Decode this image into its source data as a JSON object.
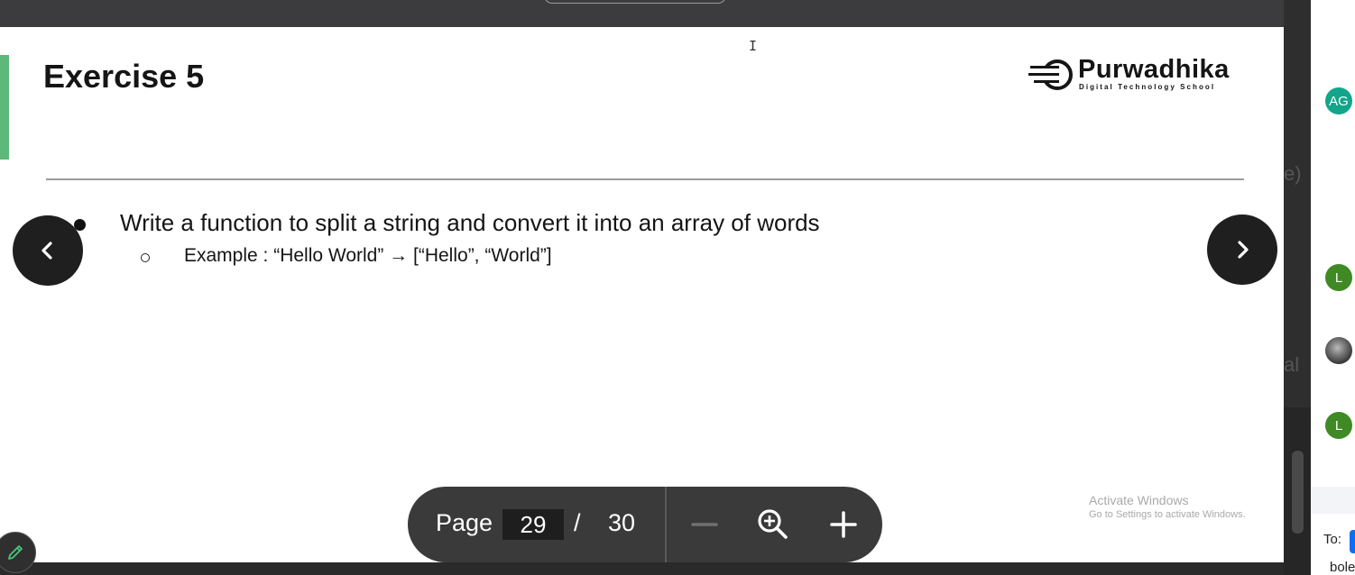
{
  "slide": {
    "title": "Exercise 5",
    "logo": {
      "name": "Purwadhika",
      "tagline": "Digital Technology School"
    },
    "bullet": "Write a function to split a string and convert it into an array of words",
    "sub_bullet": "Example : “Hello World” → [“Hello”, “World”]"
  },
  "pager": {
    "label": "Page",
    "current": "29",
    "separator": "/",
    "total": "30"
  },
  "watermark": {
    "line1": "Activate Windows",
    "line2": "Go to Settings to activate Windows."
  },
  "side_panel": {
    "ghost_top": "e)",
    "ghost_bottom": "al",
    "avatars": [
      {
        "initials": "AG",
        "color": "#12a58a"
      },
      {
        "initials": "L",
        "color": "#3f8a24"
      },
      {
        "initials": "",
        "color": "#777777"
      },
      {
        "initials": "L",
        "color": "#3f8a24"
      }
    ],
    "to_label": "To:",
    "message_fragment": "bole"
  },
  "colors": {
    "accent_bar": "#5cb97a",
    "nav_button": "#1f1f1f",
    "pager_bg": "#3a3a3a"
  },
  "icons": [
    "chevron-left-icon",
    "chevron-right-icon",
    "minus-icon",
    "zoom-in-icon",
    "plus-icon",
    "pencil-icon",
    "text-cursor-icon",
    "purwadhika-logo-icon"
  ]
}
